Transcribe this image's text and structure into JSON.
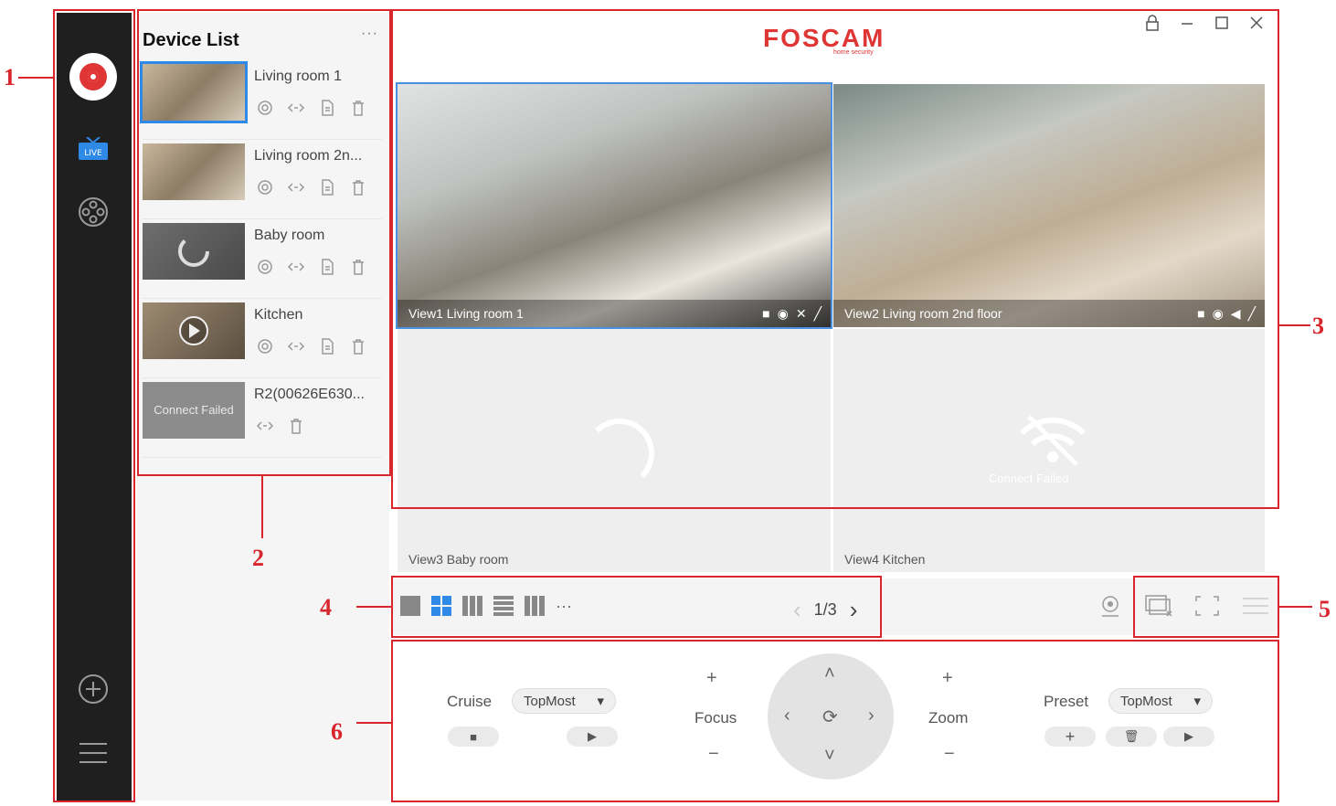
{
  "app": {
    "brand": "FOSCAM",
    "brand_tagline": "home security"
  },
  "window_controls": [
    "lock",
    "minimize",
    "maximize",
    "close"
  ],
  "sidebar": {
    "items": [
      "logo",
      "live-view",
      "playback",
      "add-device",
      "menu"
    ]
  },
  "device_list": {
    "title": "Device List",
    "more": "···",
    "devices": [
      {
        "name": "Living room 1",
        "selected": true
      },
      {
        "name": "Living room 2n...",
        "selected": false
      },
      {
        "name": "Baby room",
        "selected": false
      },
      {
        "name": "Kitchen",
        "selected": false
      },
      {
        "name": "R2(00626E630...",
        "status_text": "Connect Failed"
      }
    ]
  },
  "views": [
    {
      "label": "View1 Living room 1",
      "active": true
    },
    {
      "label": "View2 Living room 2nd floor"
    },
    {
      "label": "View3 Baby room"
    },
    {
      "label": "View4 Kitchen",
      "status": "Connect Failed"
    }
  ],
  "toolbar": {
    "page": "1/3",
    "prev": "‹",
    "next": "›",
    "more_layouts": "···"
  },
  "ptz": {
    "cruise_label": "Cruise",
    "cruise_value": "TopMost",
    "focus_label": "Focus",
    "zoom_label": "Zoom",
    "preset_label": "Preset",
    "preset_value": "TopMost"
  },
  "annotations": [
    "1",
    "2",
    "3",
    "4",
    "5",
    "6"
  ],
  "colors": {
    "accent": "#2e8ae6",
    "brand": "#e03535",
    "annotation": "#d9262c",
    "sidebar": "#1f1f1f"
  }
}
